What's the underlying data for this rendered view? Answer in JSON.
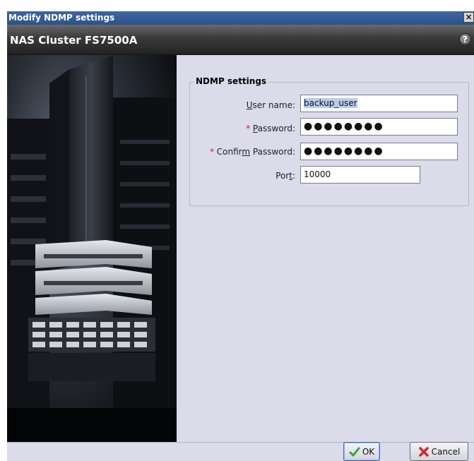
{
  "window": {
    "title": "Modify NDMP settings",
    "close_glyph": "×"
  },
  "header": {
    "cluster_name": "NAS Cluster FS7500A",
    "help_glyph": "?"
  },
  "form": {
    "legend": "NDMP settings",
    "required_mark": "*",
    "fields": {
      "user_name": {
        "label_prefix": "",
        "mnemonic": "U",
        "label_suffix": "ser name:",
        "value": "backup_user"
      },
      "password": {
        "label_prefix": "",
        "mnemonic": "P",
        "label_suffix": "assword:",
        "value": "●●●●●●●●"
      },
      "confirm_password": {
        "label_prefix": "Confir",
        "mnemonic": "m",
        "label_suffix": " Password:",
        "value": "●●●●●●●●"
      },
      "port": {
        "label_prefix": "Por",
        "mnemonic": "t",
        "label_suffix": ":",
        "value": "10000"
      }
    }
  },
  "buttons": {
    "ok_label": "OK",
    "cancel_label": "Cancel"
  },
  "icons": {
    "close": "close-icon",
    "help": "help-icon",
    "ok": "checkmark-icon",
    "cancel": "x-icon"
  },
  "colors": {
    "title_bar": "#345b94",
    "dialog_background": "#dbdbea",
    "header_background": "#3a3a3a",
    "required_marker": "#cc2222",
    "selection": "#b7cbee"
  }
}
